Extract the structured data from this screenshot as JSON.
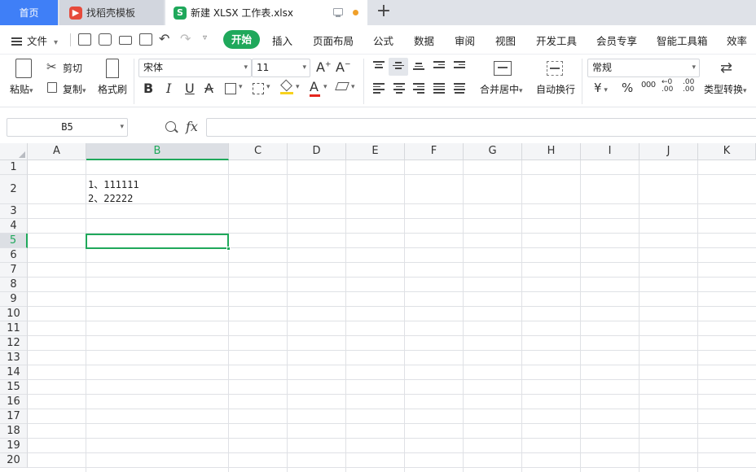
{
  "tabs": {
    "home": "首页",
    "template": "找稻壳模板",
    "file": "新建 XLSX 工作表.xlsx",
    "file_logo_letter": "S"
  },
  "menu": {
    "file": "文件",
    "items": [
      "开始",
      "插入",
      "页面布局",
      "公式",
      "数据",
      "审阅",
      "视图",
      "开发工具",
      "会员专享",
      "智能工具箱",
      "效率"
    ]
  },
  "ribbon": {
    "paste": "粘贴",
    "cut": "剪切",
    "copy": "复制",
    "format_painter": "格式刷",
    "font_name": "宋体",
    "font_size": "11",
    "merge_center": "合并居中",
    "wrap_text": "自动换行",
    "number_format": "常规",
    "currency_symbol": "¥",
    "percent_symbol": "%",
    "thousands_symbol": "000",
    "convert_type": "类型转换",
    "bold": "B",
    "italic": "I",
    "underline": "U",
    "strike": "A",
    "font_color": "A",
    "grow_font": "A",
    "shrink_font": "A",
    "decimal_add": ".00",
    "decimal_remove": ".00"
  },
  "formula_bar": {
    "name_box": "B5",
    "fx": "fx",
    "content": ""
  },
  "sheet": {
    "columns": [
      "A",
      "B",
      "C",
      "D",
      "E",
      "F",
      "G",
      "H",
      "I",
      "J",
      "K"
    ],
    "rows": [
      "1",
      "2",
      "3",
      "4",
      "5",
      "6",
      "7",
      "8",
      "9",
      "10",
      "11",
      "12",
      "13",
      "14",
      "15",
      "16",
      "17",
      "18",
      "19",
      "20"
    ],
    "active_column": "B",
    "active_row": "5",
    "cell_B2": "1、111111\n2、22222"
  },
  "colors": {
    "accent_green": "#1fa85b",
    "home_tab_blue": "#3f7ff7",
    "template_red": "#e64a3b",
    "unsaved_dot": "#f0a02a"
  }
}
